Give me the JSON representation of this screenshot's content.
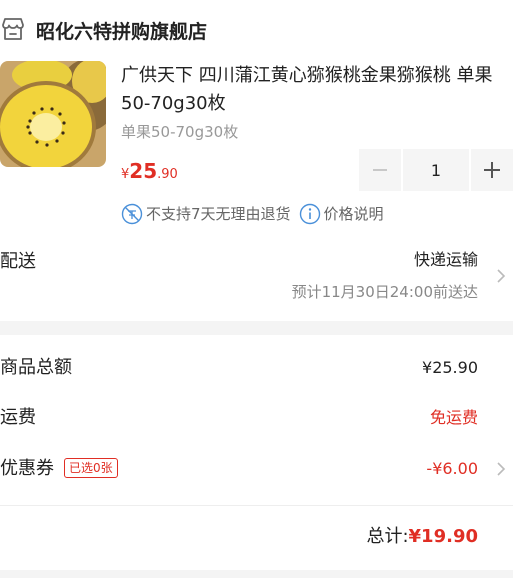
{
  "store": {
    "name": "昭化六特拼购旗舰店",
    "icon": "store-icon"
  },
  "product": {
    "title": "广供天下 四川蒲江黄心猕猴桃金果猕猴桃 单果50-70g30枚",
    "spec": "单果50-70g30枚",
    "price_currency": "¥",
    "price_int": "25",
    "price_dec": ".90",
    "quantity": "1",
    "return_policy": "不支持7天无理由退货",
    "price_info": "价格说明"
  },
  "delivery": {
    "label": "配送",
    "method": "快递运输",
    "estimate": "预计11月30日24:00前送达"
  },
  "summary": {
    "goods_total_label": "商品总额",
    "goods_total_value": "¥25.90",
    "shipping_label": "运费",
    "shipping_value": "免运费",
    "coupon_label": "优惠券",
    "coupon_badge": "已选0张",
    "coupon_value": "-¥6.00",
    "total_label": "总计:",
    "total_value": "¥19.90"
  },
  "colors": {
    "accent": "#e02e24",
    "muted": "#999999",
    "band": "#f4f4f4"
  }
}
